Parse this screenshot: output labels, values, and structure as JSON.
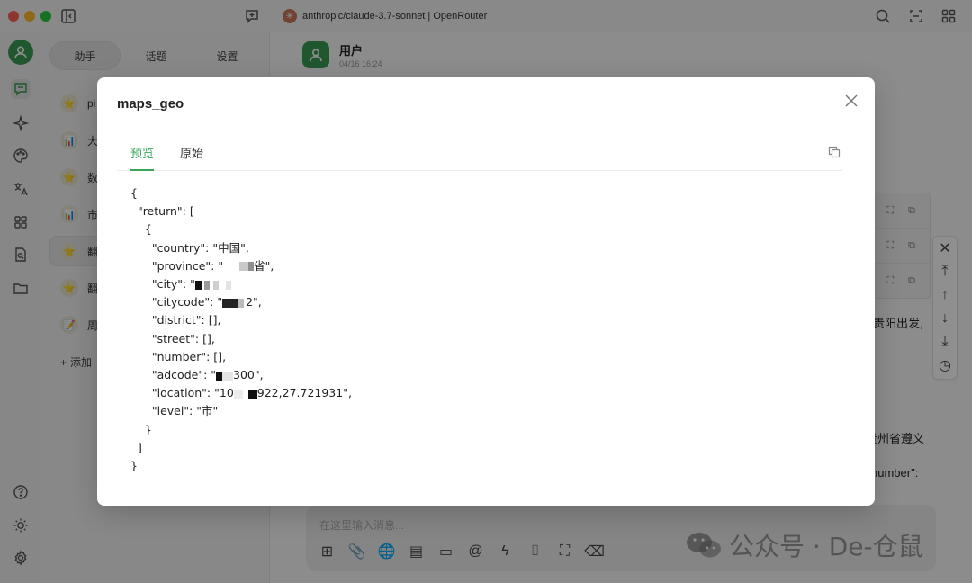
{
  "titlebar": {
    "model_title": "anthropic/claude-3.7-sonnet | OpenRouter"
  },
  "sidebar": {
    "tabs": [
      "助手",
      "话题",
      "设置"
    ],
    "items": [
      {
        "label": "pi",
        "icon": "⭐"
      },
      {
        "label": "大",
        "icon": "📊"
      },
      {
        "label": "数",
        "icon": "⭐"
      },
      {
        "label": "市",
        "icon": "📊"
      },
      {
        "label": "翻",
        "icon": "⭐"
      },
      {
        "label": "翻",
        "icon": "⭐"
      },
      {
        "label": "周",
        "icon": "📝"
      }
    ],
    "add_label": "添加"
  },
  "main": {
    "user_name": "用户",
    "user_time": "04/16 16:24",
    "right_text_1": "贵阳出发,",
    "right_text_2": "贵州省遵义",
    "right_text_3": "number\":",
    "input_placeholder": "在这里输入消息..."
  },
  "watermark": {
    "text": "公众号 · De-仓鼠"
  },
  "modal": {
    "title": "maps_geo",
    "tabs": [
      "预览",
      "原始"
    ],
    "json_lines": [
      "{",
      "  \"return\": [",
      "    {",
      "      \"country\": \"中国\",",
      "      \"province\": \"",
      "      \"city\": \"",
      "      \"citycode\": \"",
      "      \"district\": [],",
      "      \"street\": [],",
      "      \"number\": [],",
      "      \"adcode\": \"",
      "      \"location\": \"10",
      "      \"level\": \"市\"",
      "    }",
      "  ]",
      "}"
    ],
    "province_suffix": "省\",",
    "citycode_suffix": "2\",",
    "adcode_suffix": "300\",",
    "location_suffix": "922,27.721931\","
  },
  "colors": {
    "accent": "#3aa55a",
    "avatar": "#3a9c55"
  }
}
